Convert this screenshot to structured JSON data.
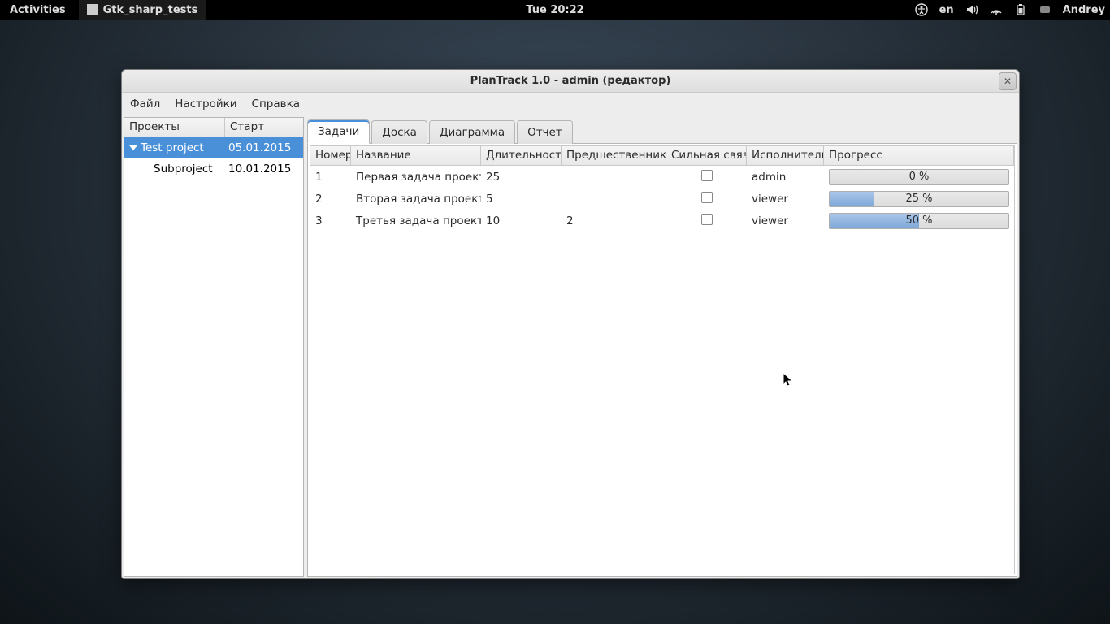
{
  "topbar": {
    "activities": "Activities",
    "task_title": "Gtk_sharp_tests",
    "clock": "Tue 20:22",
    "lang": "en",
    "user": "Andrey"
  },
  "window": {
    "title": "PlanTrack 1.0 - admin (редактор)"
  },
  "menu": {
    "file": "Файл",
    "settings": "Настройки",
    "help": "Справка"
  },
  "sidebar": {
    "col_projects": "Проекты",
    "col_start": "Старт",
    "rows": [
      {
        "name": "Test project",
        "start": "05.01.2015"
      },
      {
        "name": "Subproject",
        "start": "10.01.2015"
      }
    ]
  },
  "tabs": {
    "tasks": "Задачи",
    "board": "Доска",
    "diagram": "Диаграмма",
    "report": "Отчет"
  },
  "grid": {
    "cols": {
      "num": "Номер",
      "name": "Название",
      "dur": "Длительность",
      "pred": "Предшественники",
      "link": "Сильная связь",
      "exec": "Исполнитель",
      "prog": "Прогресс"
    },
    "rows": [
      {
        "num": "1",
        "name": "Первая задача проекта",
        "dur": "25",
        "pred": "",
        "exec": "admin",
        "prog": 0,
        "prog_label": "0 %"
      },
      {
        "num": "2",
        "name": "Вторая задача проекта",
        "dur": "5",
        "pred": "",
        "exec": "viewer",
        "prog": 25,
        "prog_label": "25 %"
      },
      {
        "num": "3",
        "name": "Третья задача проекта",
        "dur": "10",
        "pred": "2",
        "exec": "viewer",
        "prog": 50,
        "prog_label": "50 %"
      }
    ]
  }
}
